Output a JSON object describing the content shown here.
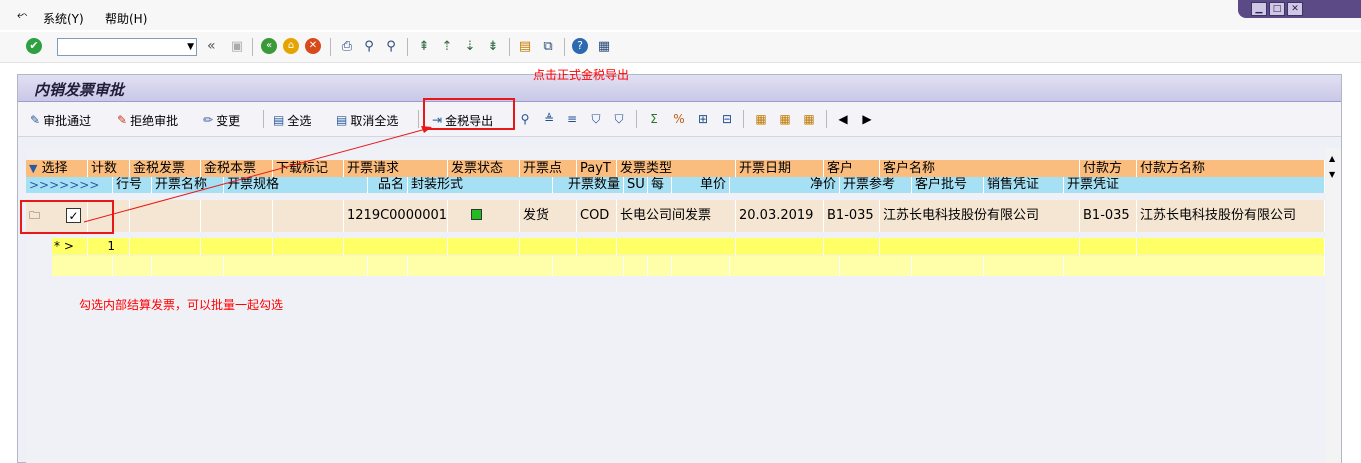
{
  "menu": {
    "items": [
      "系统(Y)",
      "帮助(H)"
    ]
  },
  "window_controls": [
    "▁",
    "□",
    "✕"
  ],
  "command_field": {
    "value": "",
    "placeholder": ""
  },
  "std_toolbar": {
    "back_glyph": "«"
  },
  "panel": {
    "title": "内销发票审批"
  },
  "app_toolbar": {
    "approve": "审批通过",
    "reject": "拒绝审批",
    "change": "变更",
    "select_all": "全选",
    "deselect_all": "取消全选",
    "tax_export": "金税导出"
  },
  "annotations": {
    "top": "点击正式金税导出",
    "bottom": "勾选内部结算发票，可以批量一起勾选"
  },
  "grid": {
    "header1": [
      "选择",
      "计数",
      "金税发票",
      "金税本票",
      "下载标记",
      "开票请求",
      "发票状态",
      "开票点",
      "PayT",
      "发票类型",
      "开票日期",
      "客户",
      "客户名称",
      "付款方",
      "付款方名称"
    ],
    "header2": [
      ">>>>>>>",
      "行号",
      "开票名称",
      "开票规格",
      "品名",
      "封装形式",
      "开票数量",
      "SU",
      "每",
      "单价",
      "净价",
      "开票参考",
      "客户批号",
      "销售凭证",
      "开票凭证"
    ],
    "row1": {
      "selected": true,
      "billing_request": "1219C0000001",
      "status_color": "#22bb22",
      "billing_point": "发货",
      "payt": "COD",
      "invoice_type": "长电公司间发票",
      "billing_date": "20.03.2019",
      "customer": "B1-035",
      "customer_name": "江苏长电科技股份有限公司",
      "payer": "B1-035",
      "payer_name": "江苏长电科技股份有限公司"
    },
    "row2": {
      "marker": "* >",
      "line_no": "1"
    }
  },
  "colors": {
    "header_orange": "#fbbd7e",
    "header_blue": "#a6e0f4",
    "row_tan": "#f5e6d3",
    "row_yellow": "#ffff66",
    "annotation_red": "#ff0000"
  }
}
